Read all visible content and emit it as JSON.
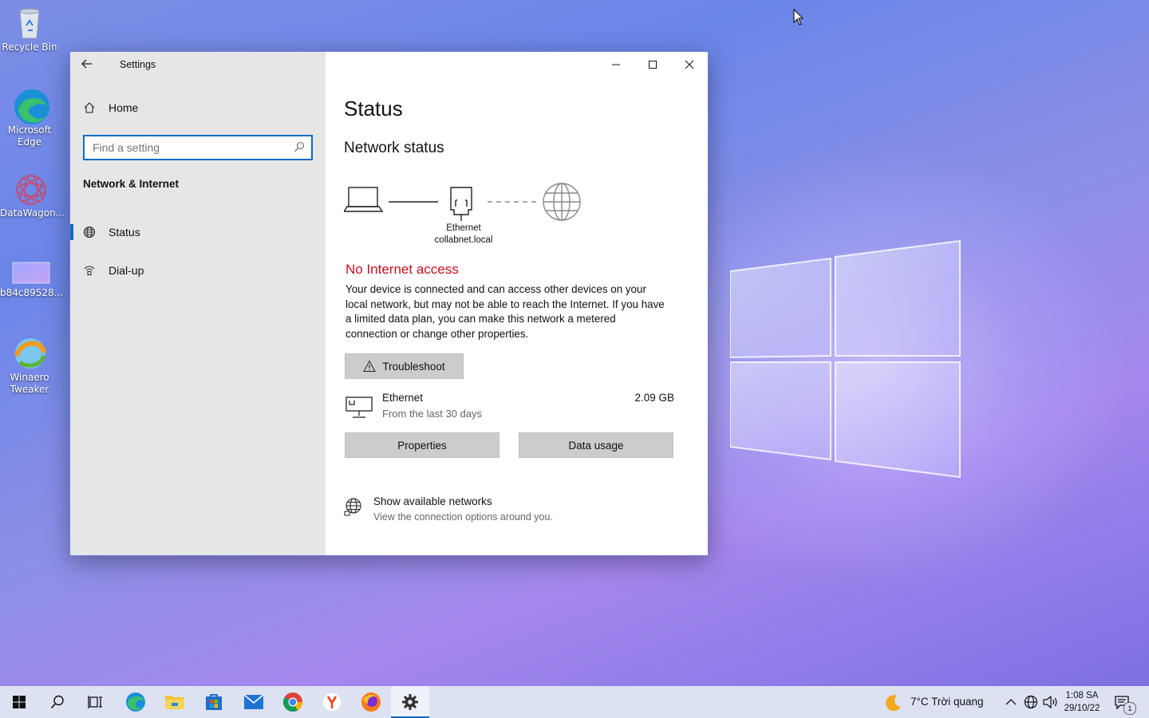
{
  "desktop": {
    "icons": [
      {
        "label": "Recycle Bin",
        "icon": "recycle-bin-icon"
      },
      {
        "label": "Microsoft Edge",
        "icon": "edge-icon"
      },
      {
        "label": "DataWagon...",
        "icon": "datawagon-icon"
      },
      {
        "label": "b84c89528...",
        "icon": "image-file-icon"
      },
      {
        "label": "Winaero Tweaker",
        "icon": "winaero-icon"
      }
    ]
  },
  "window": {
    "title": "Settings",
    "sidebar": {
      "home_label": "Home",
      "search_placeholder": "Find a setting",
      "section_title": "Network & Internet",
      "items": [
        {
          "label": "Status",
          "icon": "globe-icon",
          "active": true
        },
        {
          "label": "Dial-up",
          "icon": "dialup-icon",
          "active": false
        }
      ]
    },
    "main": {
      "heading": "Status",
      "subheading": "Network status",
      "adapter_name": "Ethernet",
      "adapter_domain": "collabnet.local",
      "status_title": "No Internet access",
      "status_description": "Your device is connected and can access other devices on your local network, but may not be able to reach the Internet. If you have a limited data plan, you can make this network a metered connection or change other properties.",
      "troubleshoot_label": "Troubleshoot",
      "connection": {
        "name": "Ethernet",
        "period": "From the last 30 days",
        "usage": "2.09 GB"
      },
      "properties_label": "Properties",
      "data_usage_label": "Data usage",
      "show_networks_title": "Show available networks",
      "show_networks_sub": "View the connection options around you."
    }
  },
  "taskbar": {
    "apps": [
      "start-icon",
      "search-icon",
      "task-view-icon",
      "edge-icon",
      "file-explorer-icon",
      "store-icon",
      "mail-icon",
      "chrome-icon",
      "yandex-icon",
      "firefox-icon",
      "settings-icon"
    ],
    "weather": "7°C  Trời quang",
    "time": "1:08 SA",
    "date": "29/10/22",
    "notification_count": "1"
  },
  "colors": {
    "accent": "#0a6bc4",
    "error": "#c50f1f",
    "sidebar_bg": "#e6e6e6",
    "button_bg": "#cccccc"
  }
}
